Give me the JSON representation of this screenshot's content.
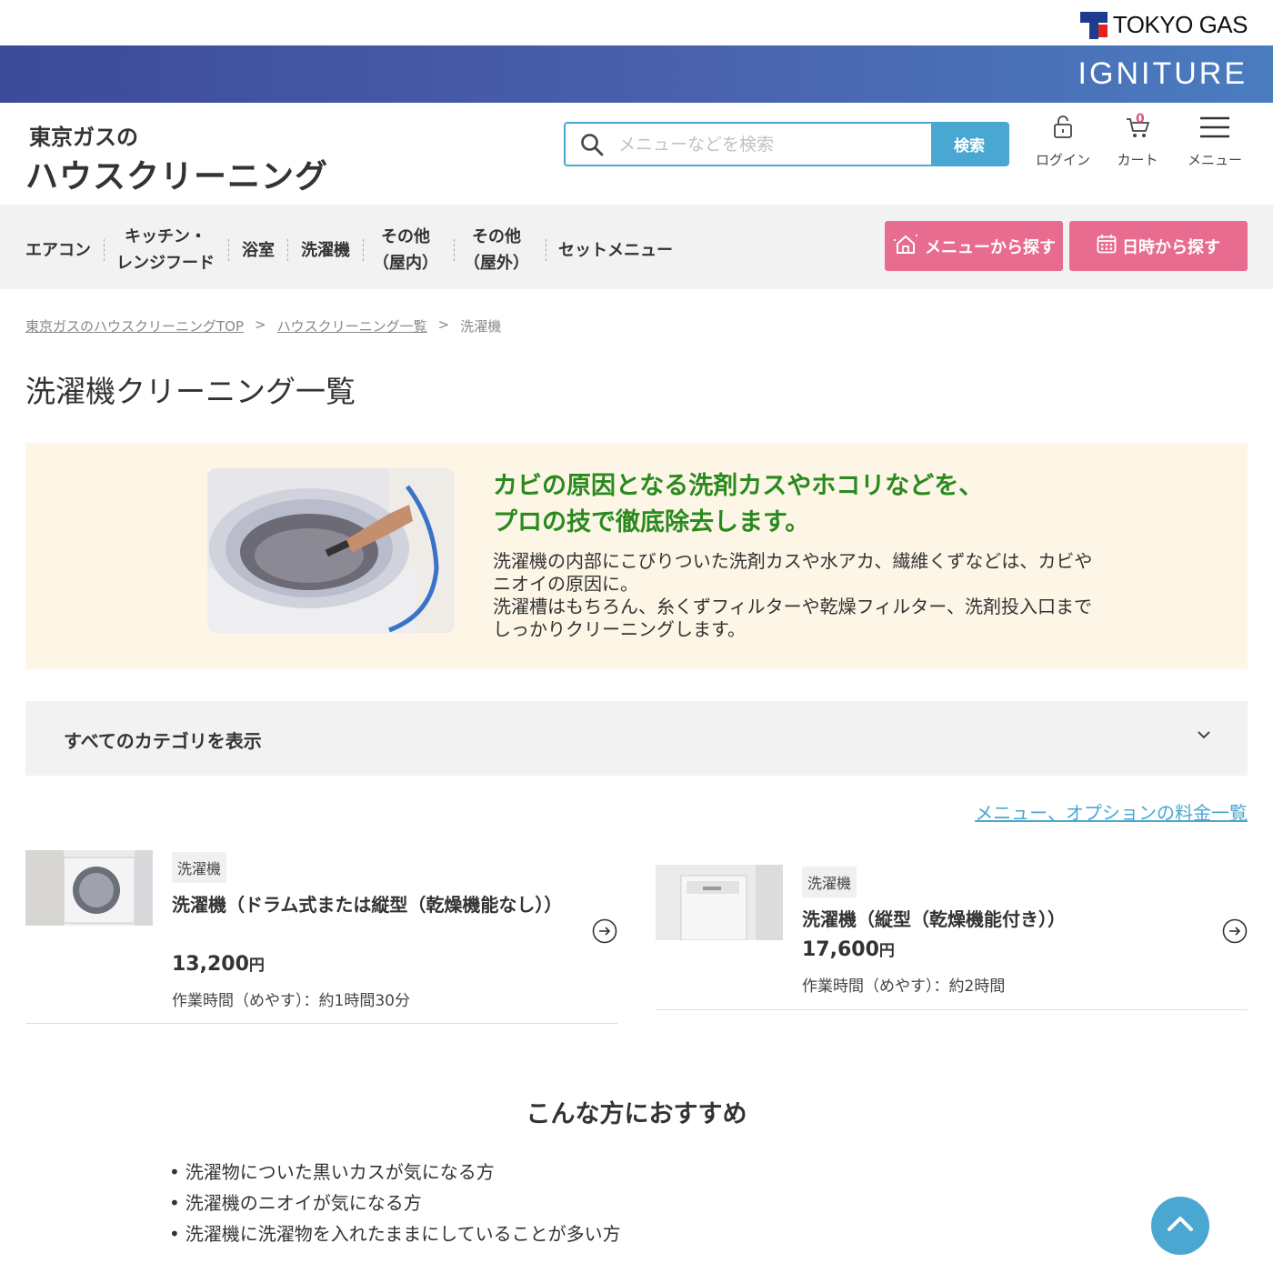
{
  "brand": {
    "corporate": "TOKYO GAS",
    "ig": "IGNITURE"
  },
  "header": {
    "site_sub": "東京ガスの",
    "site_title": "ハウスクリーニング",
    "search_placeholder": "メニューなどを検索",
    "search_button": "検索",
    "login_label": "ログイン",
    "cart_label": "カート",
    "cart_count": "0",
    "menu_label": "メニュー"
  },
  "nav": {
    "items": [
      {
        "line1": "エアコン",
        "line2": ""
      },
      {
        "line1": "キッチン・",
        "line2": "レンジフード"
      },
      {
        "line1": "浴室",
        "line2": ""
      },
      {
        "line1": "洗濯機",
        "line2": ""
      },
      {
        "line1": "その他",
        "line2": "（屋内）"
      },
      {
        "line1": "その他",
        "line2": "（屋外）"
      },
      {
        "line1": "セットメニュー",
        "line2": ""
      }
    ],
    "cta_menu": "メニューから探す",
    "cta_date": "日時から探す",
    "cta_color": "#e86c8f"
  },
  "breadcrumb": {
    "items": [
      "東京ガスのハウスクリーニングTOP",
      "ハウスクリーニング一覧",
      "洗濯機"
    ],
    "separator": ">"
  },
  "page_title": "洗濯機クリーニング一覧",
  "hero": {
    "headline_1": "カビの原因となる洗剤カスやホコリなどを、",
    "headline_2": "プロの技で徹底除去します。",
    "body_1": "洗濯機の内部にこびりついた洗剤カスや水アカ、繊維くずなどは、カビやニオイの原因に。",
    "body_2": "洗濯槽はもちろん、糸くずフィルターや乾燥フィルター、洗剤投入口までしっかりクリーニングします。",
    "headline_color": "#2a8a1e"
  },
  "category_accordion": {
    "label": "すべてのカテゴリを表示"
  },
  "price_link": "メニュー、オプションの料金一覧",
  "products": [
    {
      "tag": "洗濯機",
      "name": "洗濯機（ドラム式または縦型（乾燥機能なし））",
      "price": "13,200",
      "yen": "円",
      "time": "作業時間（めやす）：約1時間30分"
    },
    {
      "tag": "洗濯機",
      "name": "洗濯機（縦型（乾燥機能付き））",
      "price": "17,600",
      "yen": "円",
      "time": "作業時間（めやす）：約2時間"
    }
  ],
  "recommend": {
    "title": "こんな方におすすめ",
    "items": [
      "洗濯物についた黒いカスが気になる方",
      "洗濯機のニオイが気になる方",
      "洗濯機に洗濯物を入れたままにしていることが多い方"
    ]
  },
  "colors": {
    "accent": "#4aa7d1",
    "pink": "#e86c8f",
    "hero_bg": "#fdf6e7",
    "nav_bg": "#f2f2f2"
  }
}
